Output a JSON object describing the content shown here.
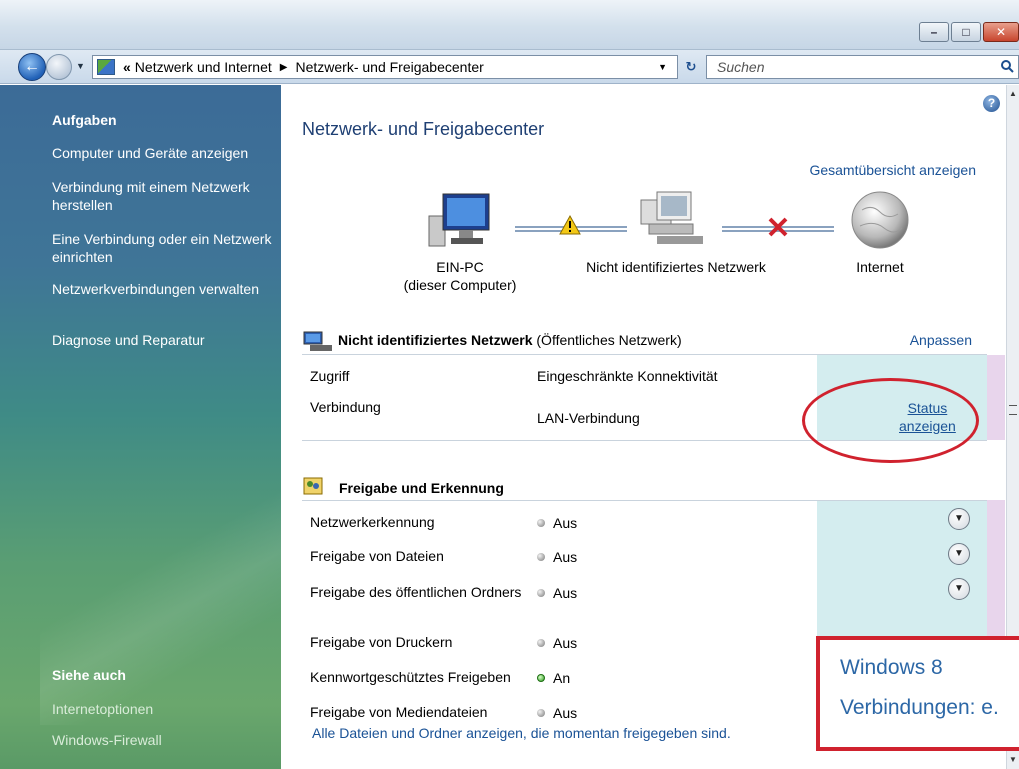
{
  "window": {
    "btn_min": "–",
    "btn_max": "□",
    "btn_close": "✕"
  },
  "nav": {
    "address": {
      "chevron": "«",
      "crumb1": "Netzwerk und Internet",
      "sep": "▶",
      "crumb2": "Netzwerk- und Freigabecenter"
    },
    "search_placeholder": "Suchen"
  },
  "sidebar": {
    "tasks_title": "Aufgaben",
    "tasks": [
      "Computer und Geräte anzeigen",
      "Verbindung mit einem Netzwerk herstellen",
      "Eine Verbindung oder ein Netzwerk einrichten",
      "Netzwerkverbindungen verwalten",
      "Diagnose und Reparatur"
    ],
    "see_also_title": "Siehe auch",
    "see_also": [
      "Internetoptionen",
      "Windows-Firewall"
    ]
  },
  "main": {
    "title": "Netzwerk- und Freigabecenter",
    "overview_link": "Gesamtübersicht anzeigen",
    "map": {
      "pc_label_line1": "EIN-PC",
      "pc_label_line2": "(dieser Computer)",
      "network_label": "Nicht identifiziertes Netzwerk",
      "internet_label": "Internet",
      "link1_status": "warning",
      "link2_status": "disconnected"
    },
    "network_section": {
      "name": "Nicht identifiziertes Netzwerk",
      "type": "(Öffentliches Netzwerk)",
      "customize_link": "Anpassen",
      "rows": [
        {
          "label": "Zugriff",
          "value": "Eingeschränkte Konnektivität"
        },
        {
          "label": "Verbindung",
          "value": "LAN-Verbindung"
        }
      ],
      "status_link_line1": "Status",
      "status_link_line2": "anzeigen"
    },
    "sharing_section": {
      "title": "Freigabe und Erkennung",
      "rows": [
        {
          "label": "Netzwerkerkennung",
          "value": "Aus"
        },
        {
          "label": "Freigabe von Dateien",
          "value": "Aus"
        },
        {
          "label": "Freigabe des öffentlichen Ordners",
          "value": "Aus"
        },
        {
          "label": "Freigabe von Druckern",
          "value": "Aus"
        },
        {
          "label": "Kennwortgeschütztes Freigeben",
          "value": "An"
        },
        {
          "label": "Freigabe von Mediendateien",
          "value": "Aus"
        }
      ]
    },
    "footer_link": "Alle Dateien und Ordner anzeigen, die momentan freigegeben sind."
  },
  "overlay": {
    "line1": "Windows 8",
    "line2": "Verbindungen: e."
  },
  "colors": {
    "accent_red": "#d0222e",
    "link_blue": "#1a5296",
    "title_blue": "#1e3f73"
  }
}
